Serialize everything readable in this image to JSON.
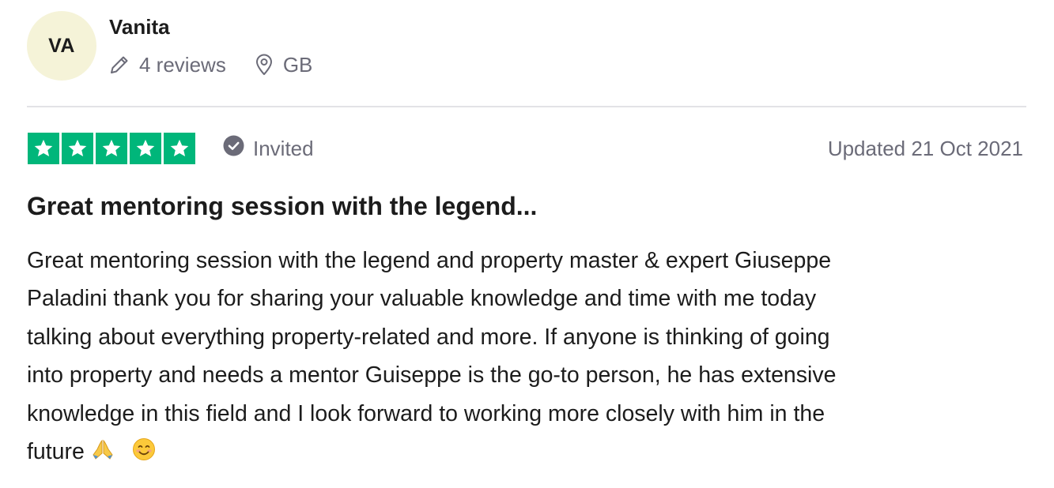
{
  "reviewer": {
    "initials": "VA",
    "name": "Vanita",
    "reviews_count": "4 reviews",
    "country": "GB",
    "avatar_color": "#f5f3d8",
    "icons": {
      "reviews": "pencil-icon",
      "country": "location-pin-icon"
    }
  },
  "review": {
    "rating": 5,
    "max_rating": 5,
    "star_color": "#00b67a",
    "status": "Invited",
    "status_icon": "check-circle-icon",
    "date": "Updated 21 Oct 2021",
    "title": "Great mentoring session with the legend...",
    "body_lines": [
      "Great mentoring session with the legend and property master & expert Giuseppe",
      "Paladini thank you for sharing your valuable knowledge and time with me today",
      "talking about everything property-related and more. If anyone is thinking of going",
      "into property and needs a mentor Guiseppe is the go-to person, he has extensive",
      "knowledge in this field and I look forward to working more closely with him in the",
      "future"
    ],
    "body_emojis": [
      "folded-hands-emoji",
      "smiling-face-emoji"
    ]
  }
}
